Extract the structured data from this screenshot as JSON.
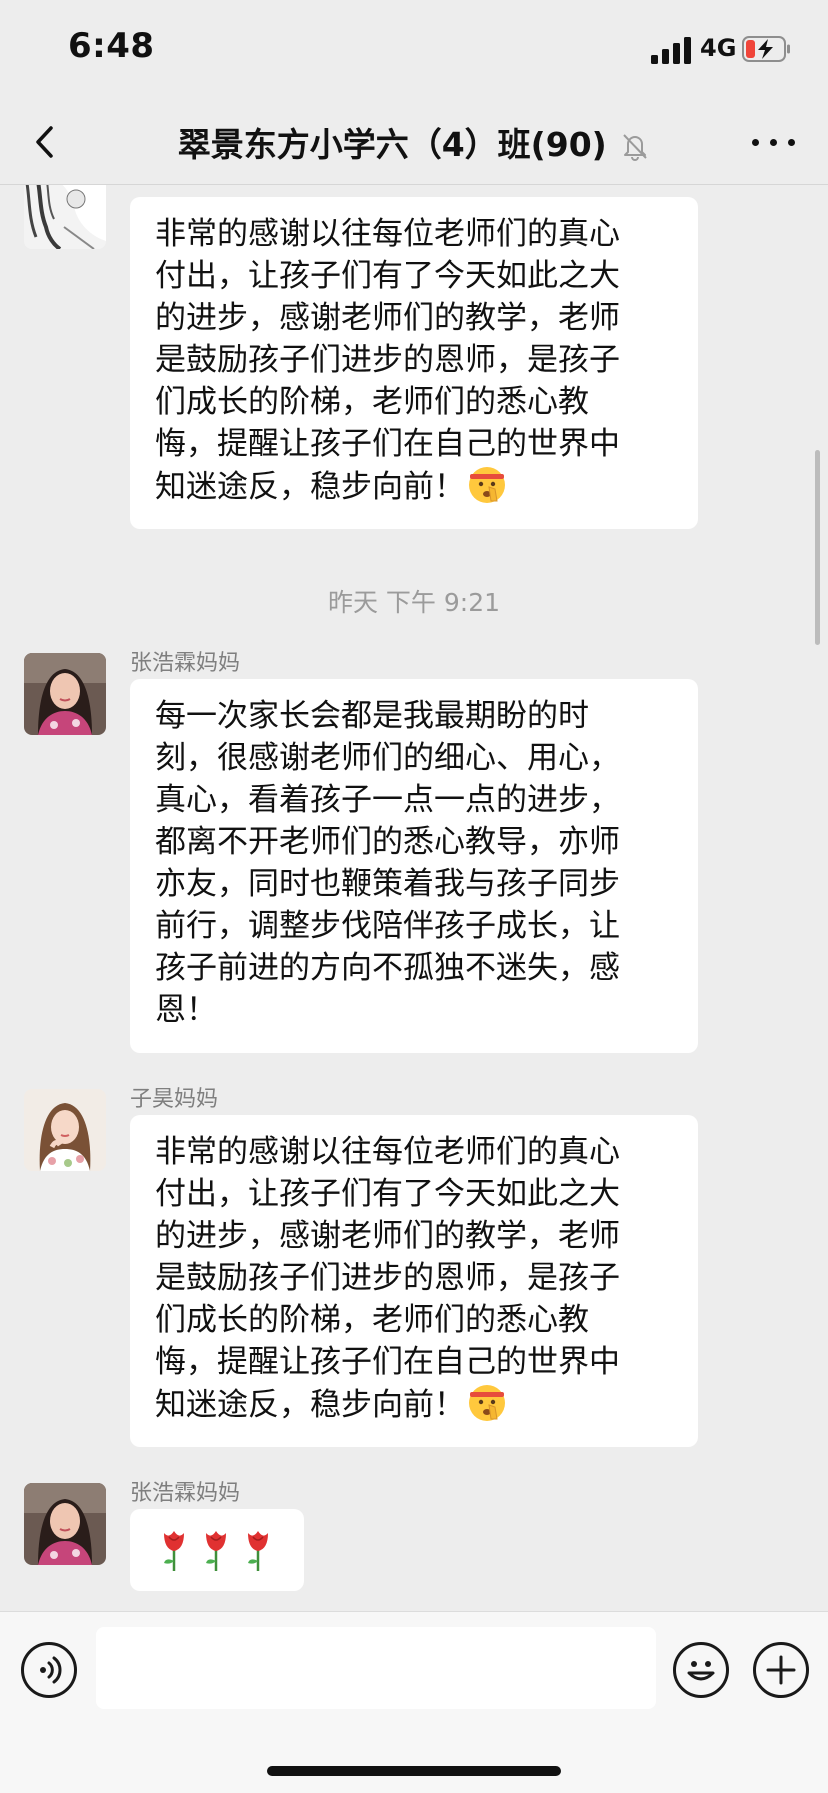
{
  "status_bar": {
    "time": "6:48",
    "network": "4G",
    "battery_color": "#f0453a"
  },
  "nav": {
    "title": "翠景东方小学六（4）班(90)"
  },
  "messages": [
    {
      "sender": "",
      "text": "非常的感谢以往每位老师们的真心\n付出，让孩子们有了今天如此之大\n的进步，感谢老师们的教学，老师\n是鼓励孩子们进步的恩师，是孩子\n们成长的阶梯，老师们的悉心教\n悔，提醒让孩子们在自己的世界中\n知迷途反，稳步向前！",
      "emoji": "shushing-face"
    },
    {
      "sender": "张浩霖妈妈",
      "text": "每一次家长会都是我最期盼的时\n刻，很感谢老师们的细心、用心，\n真心，看着孩子一点一点的进步，\n都离不开老师们的悉心教导，亦师\n亦友，同时也鞭策着我与孩子同步\n前行，调整步伐陪伴孩子成长，让\n孩子前进的方向不孤独不迷失，感\n恩！"
    },
    {
      "sender": "子昊妈妈",
      "text": "非常的感谢以往每位老师们的真心\n付出，让孩子们有了今天如此之大\n的进步，感谢老师们的教学，老师\n是鼓励孩子们进步的恩师，是孩子\n们成长的阶梯，老师们的悉心教\n悔，提醒让孩子们在自己的世界中\n知迷途反，稳步向前！",
      "emoji": "shushing-face"
    },
    {
      "sender": "张浩霖妈妈",
      "text": "",
      "emoji": "rose x3"
    }
  ],
  "timestamp": "昨天 下午 9:21",
  "input_bar": {
    "input_value": "",
    "icons": [
      "voice-icon",
      "emoji-icon",
      "plus-icon"
    ]
  },
  "colors": {
    "background": "#ededed",
    "bubble": "#ffffff",
    "name_text": "#7f7f7f"
  }
}
